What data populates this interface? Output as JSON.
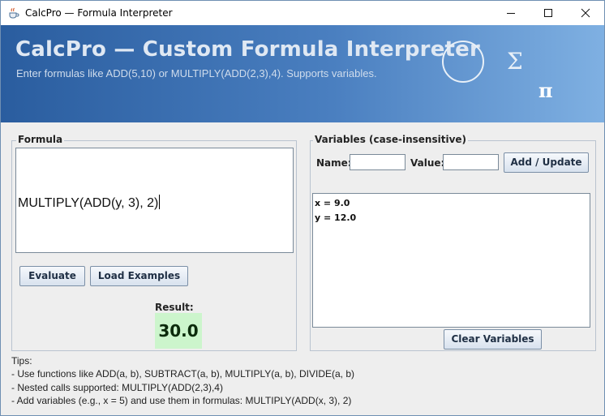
{
  "window": {
    "title": "CalcPro — Formula Interpreter"
  },
  "banner": {
    "title": "CalcPro — Custom Formula Interpreter",
    "subtitle": "Enter formulas like ADD(5,10) or MULTIPLY(ADD(2,3),4). Supports variables.",
    "sigma": "Σ",
    "pi": "π"
  },
  "formula": {
    "legend": "Formula",
    "value": "MULTIPLY(ADD(y, 3), 2)",
    "evaluate_label": "Evaluate",
    "load_examples_label": "Load Examples",
    "result_label": "Result:",
    "result_value": "30.0"
  },
  "variables": {
    "legend": "Variables (case-insensitive)",
    "name_label": "Name:",
    "name_value": "",
    "value_label": "Value:",
    "value_value": "",
    "add_update_label": "Add / Update",
    "items": [
      "x = 9.0",
      "y = 12.0"
    ],
    "clear_label": "Clear Variables"
  },
  "tips": {
    "heading": "Tips:",
    "lines": [
      "- Use functions like ADD(a, b), SUBTRACT(a, b), MULTIPLY(a, b), DIVIDE(a, b)",
      "- Nested calls supported: MULTIPLY(ADD(2,3),4)",
      "- Add variables (e.g., x = 5) and use them in formulas: MULTIPLY(ADD(x, 3), 2)"
    ]
  },
  "icons": {
    "app": "java-cup-icon",
    "minimize": "minimize-icon",
    "maximize": "maximize-icon",
    "close": "close-icon"
  },
  "colors": {
    "banner_start": "#2a5d9f",
    "banner_end": "#7fb0e2",
    "result_background": "#ccf5cc"
  }
}
